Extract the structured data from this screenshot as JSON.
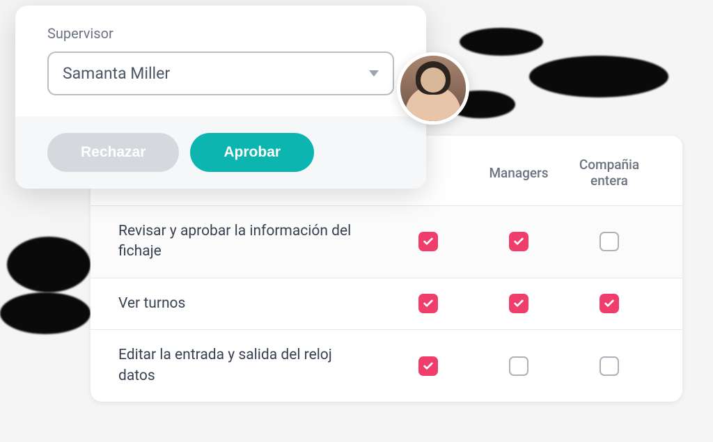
{
  "supervisor_modal": {
    "label": "Supervisor",
    "selected_name": "Samanta Miller",
    "reject_label": "Rechazar",
    "approve_label": "Aprobar"
  },
  "permissions_table": {
    "columns": {
      "col1": "",
      "col2": "Managers",
      "col3": "Compañia entera"
    },
    "rows": [
      {
        "label": "Revisar y aprobar la información del fichaje",
        "c1": true,
        "c2": true,
        "c3": false
      },
      {
        "label": "Ver turnos",
        "c1": true,
        "c2": true,
        "c3": true
      },
      {
        "label": "Editar la entrada y salida del reloj datos",
        "c1": true,
        "c2": false,
        "c3": false
      }
    ]
  }
}
